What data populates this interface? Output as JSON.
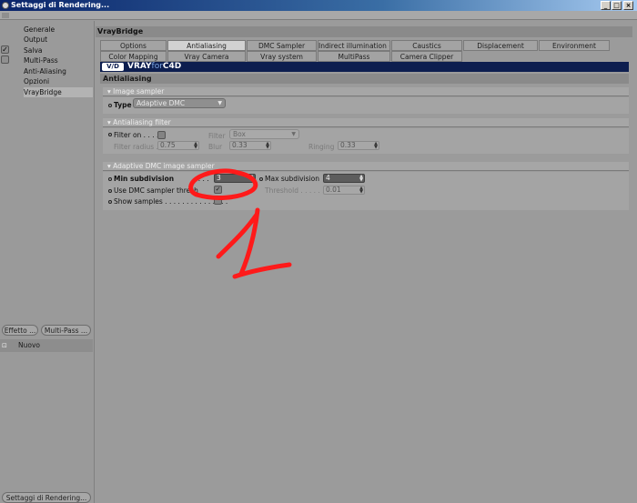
{
  "window": {
    "title": "Settaggi di Rendering...",
    "buttons": [
      "_",
      "□",
      "×"
    ]
  },
  "sidebar": {
    "items": [
      {
        "label": "Generale",
        "checked": false
      },
      {
        "label": "Output",
        "checked": false
      },
      {
        "label": "Salva",
        "checked": true
      },
      {
        "label": "Multi-Pass",
        "checked": false
      },
      {
        "label": "Anti-Aliasing",
        "checked": false
      },
      {
        "label": "Opzioni",
        "checked": false
      },
      {
        "label": "VrayBridge",
        "checked": false,
        "selected": true
      }
    ],
    "check_mark": "✓",
    "effect_button": "Effetto ...",
    "multipass_button": "Multi-Pass ...",
    "list_items": [
      "Nuovo"
    ],
    "bottom_button": "Settaggi di Rendering..."
  },
  "main": {
    "header": "VrayBridge",
    "tabs_row1": [
      "Options",
      "Antialiasing",
      "DMC Sampler",
      "Indirect illumination (GI)",
      "Caustics",
      "Displacement",
      "Environment"
    ],
    "tabs_row2": [
      "Color Mapping",
      "Vray Camera",
      "Vray system",
      "MultiPass",
      "Camera Clipper"
    ],
    "active_tab": "Antialiasing",
    "banner": {
      "logo": "V∕D",
      "brand_a": "VRAY",
      "brand_b": "for",
      "brand_c": "C4D"
    },
    "section_title": "Antialiasing",
    "image_sampler": {
      "title": "Image sampler",
      "type_label": "Type",
      "type_value": "Adaptive DMC"
    },
    "aa_filter": {
      "title": "Antialiasing filter",
      "filter_on_label": "Filter on . . . .",
      "filter_label": "Filter",
      "filter_value": "Box",
      "radius_label": "Filter radius . .",
      "radius_value": "0.75",
      "blur_label": "Blur",
      "blur_value": "0.33",
      "ringing_label": "Ringing",
      "ringing_value": "0.33"
    },
    "dmc_sampler": {
      "title": "Adaptive DMC image sampler",
      "min_sub_label": "Min subdivision",
      "min_sub_dots": ". . . .",
      "min_sub_value": "3",
      "max_sub_label": "Max subdivision",
      "max_sub_value": "4",
      "use_dmc_label": "Use DMC sampler thresh",
      "use_dmc_checked": true,
      "threshold_label": "Threshold . . . . . . .",
      "threshold_value": "0.01",
      "show_samples_label": "Show samples . . . . . . . . . . . . . . ."
    },
    "annotation": {
      "text": "1",
      "color": "#ff1a1a"
    }
  }
}
